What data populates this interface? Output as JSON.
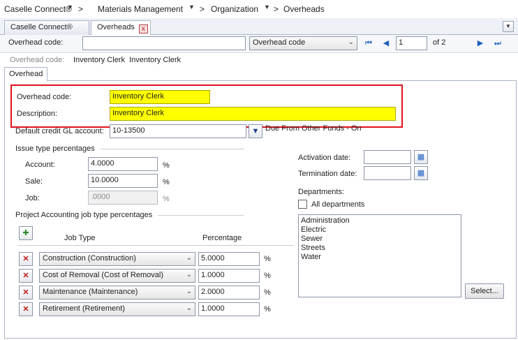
{
  "breadcrumb": {
    "items": [
      "Caselle Connect®",
      "Materials Management",
      "Organization",
      "Overheads"
    ],
    "separator": ">"
  },
  "tabs": {
    "items": [
      "Caselle Connect®",
      "Overheads"
    ],
    "close_glyph": "x",
    "menu_glyph": "▼"
  },
  "toolbar": {
    "code_label": "Overhead code:",
    "code_value": "",
    "lookup_select": "Overhead code",
    "page_value": "1",
    "page_of": "of 2"
  },
  "info": {
    "label": "Overhead code:",
    "value": "Inventory Clerk  Inventory Clerk"
  },
  "inner_tab": "Overhead",
  "form": {
    "code_label": "Overhead code:",
    "code_value": "Inventory Clerk",
    "desc_label": "Description:",
    "desc_value": "Inventory Clerk",
    "gl_label": "Default credit GL account:",
    "gl_value": "10-13500",
    "gl_desc": "Due From Other Funds - On"
  },
  "issue": {
    "title": "Issue type percentages",
    "account_label": "Account:",
    "account_value": "4.0000",
    "sale_label": "Sale:",
    "sale_value": "10.0000",
    "job_label": "Job:",
    "job_value": ".0000",
    "pct": "%"
  },
  "dates": {
    "activation_label": "Activation date:",
    "activation_value": "",
    "termination_label": "Termination date:",
    "termination_value": ""
  },
  "departments": {
    "label": "Departments:",
    "all_label": "All departments",
    "all_checked": false,
    "items": [
      "Administration",
      "Electric",
      "Sewer",
      "Streets",
      "Water"
    ],
    "select_button": "Select..."
  },
  "project": {
    "title": "Project Accounting job type percentages",
    "col_job": "Job Type",
    "col_pct": "Percentage",
    "pct": "%",
    "rows": [
      {
        "job": "Construction (Construction)",
        "pct": "5.0000"
      },
      {
        "job": "Cost of Removal (Cost of Removal)",
        "pct": "1.0000"
      },
      {
        "job": "Maintenance (Maintenance)",
        "pct": "2.0000"
      },
      {
        "job": "Retirement (Retirement)",
        "pct": "1.0000"
      }
    ]
  },
  "colors": {
    "highlight_border": "#e0121a",
    "required_field": "#ffff00",
    "nav_blue": "#1f5fbf"
  }
}
